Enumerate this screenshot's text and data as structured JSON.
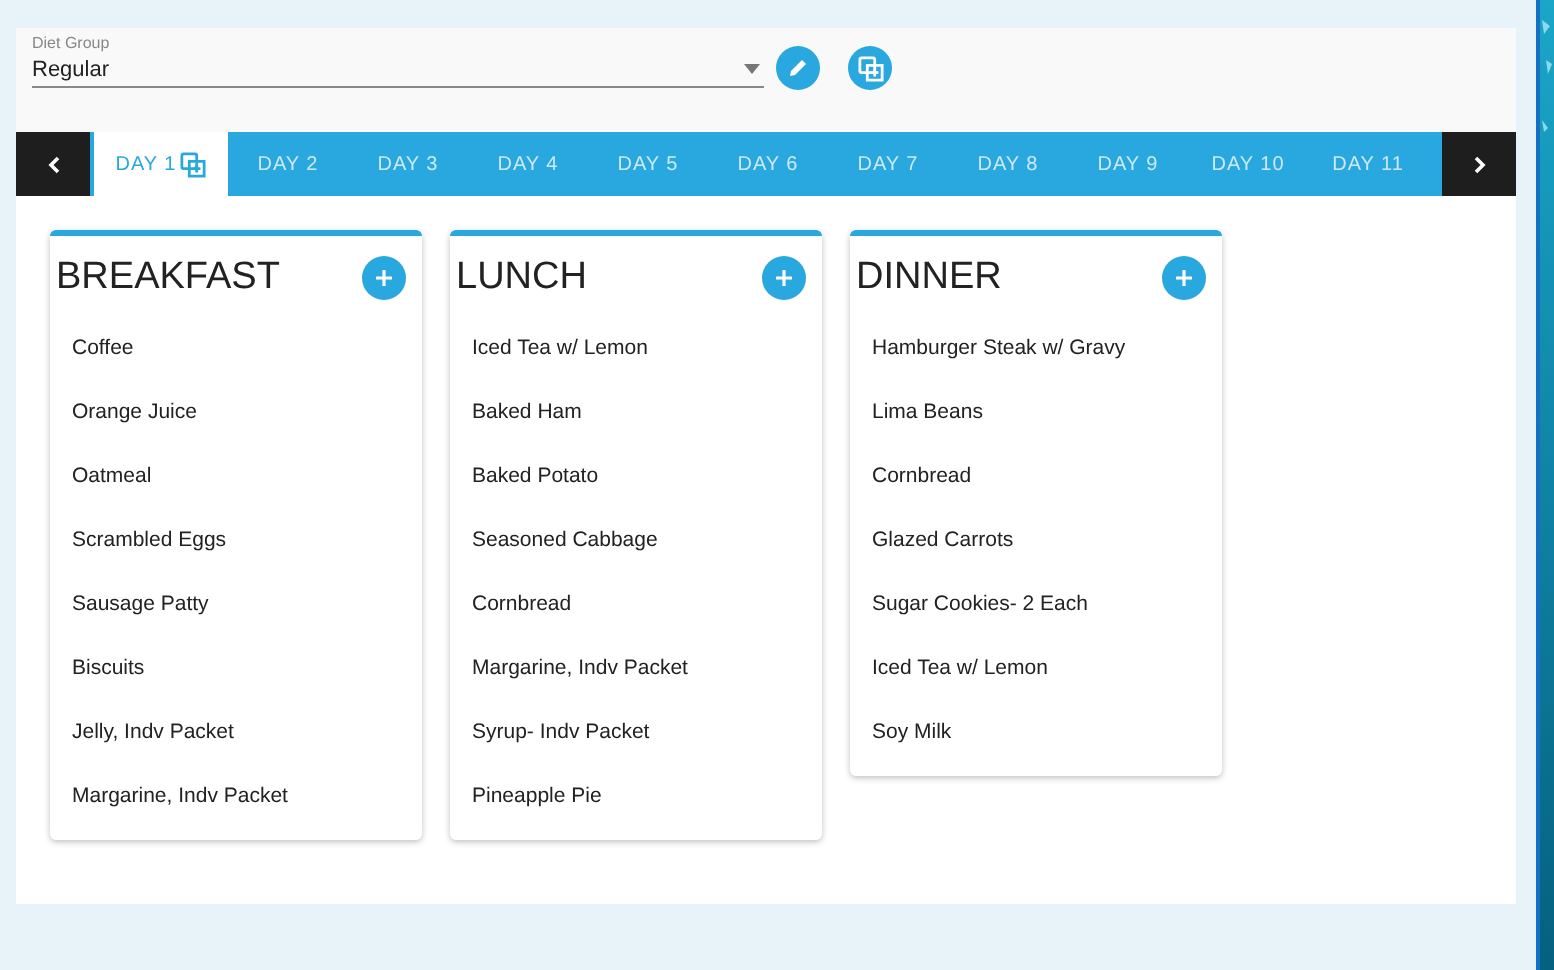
{
  "diet_group": {
    "label": "Diet Group",
    "value": "Regular"
  },
  "tabs": [
    {
      "label": "DAY 1",
      "selected": true
    },
    {
      "label": "DAY 2",
      "selected": false
    },
    {
      "label": "DAY 3",
      "selected": false
    },
    {
      "label": "DAY 4",
      "selected": false
    },
    {
      "label": "DAY 5",
      "selected": false
    },
    {
      "label": "DAY 6",
      "selected": false
    },
    {
      "label": "DAY 7",
      "selected": false
    },
    {
      "label": "DAY 8",
      "selected": false
    },
    {
      "label": "DAY 9",
      "selected": false
    },
    {
      "label": "DAY 10",
      "selected": false
    },
    {
      "label": "DAY 11",
      "selected": false
    }
  ],
  "meals": [
    {
      "title": "BREAKFAST",
      "items": [
        "Coffee",
        "Orange Juice",
        "Oatmeal",
        "Scrambled Eggs",
        "Sausage Patty",
        "Biscuits",
        "Jelly, Indv Packet",
        "Margarine, Indv Packet"
      ]
    },
    {
      "title": "LUNCH",
      "items": [
        "Iced Tea w/ Lemon",
        "Baked Ham",
        "Baked Potato",
        "Seasoned Cabbage",
        "Cornbread",
        "Margarine, Indv Packet",
        "Syrup- Indv Packet",
        "Pineapple Pie"
      ]
    },
    {
      "title": "DINNER",
      "items": [
        "Hamburger Steak w/ Gravy",
        "Lima Beans",
        "Cornbread",
        "Glazed Carrots",
        "Sugar Cookies- 2 Each",
        "Iced Tea w/ Lemon",
        "Soy Milk"
      ]
    }
  ]
}
